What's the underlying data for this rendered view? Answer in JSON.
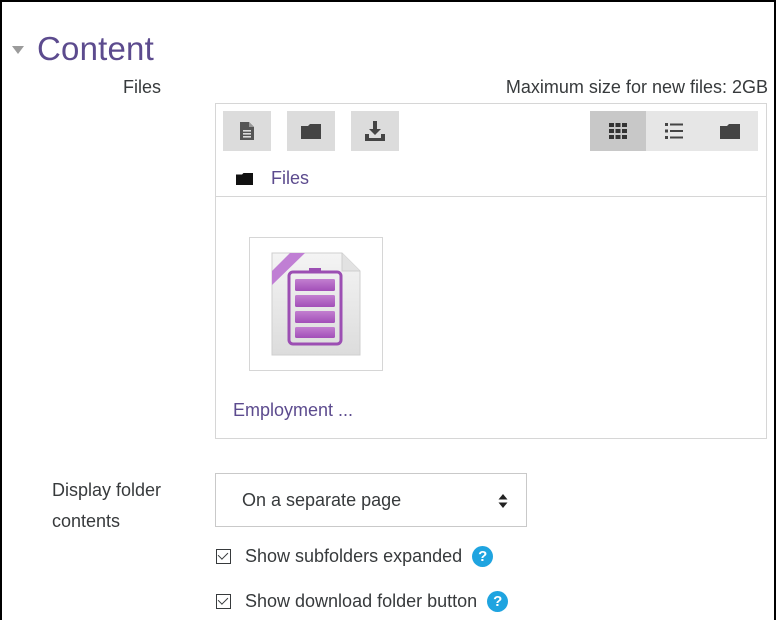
{
  "section": {
    "title": "Content"
  },
  "files_field": {
    "label": "Files",
    "max_size": "Maximum size for new files: 2GB"
  },
  "filepicker": {
    "toolbar": {
      "left_buttons": [
        "add-file-icon",
        "create-folder-icon",
        "download-icon"
      ],
      "view_buttons": [
        "grid-view-icon",
        "list-view-icon",
        "tree-view-icon"
      ],
      "active_view": "grid-view-icon"
    },
    "breadcrumb": "Files",
    "files": [
      {
        "name": "Employment ...",
        "icon": "spreadsheet-file-icon"
      }
    ]
  },
  "display_folder": {
    "label_line1": "Display folder",
    "label_line2": "contents",
    "selected": "On a separate page"
  },
  "options": [
    {
      "label": "Show subfolders expanded",
      "checked": true
    },
    {
      "label": "Show download folder button",
      "checked": true
    }
  ],
  "colors": {
    "accent": "#5c4b8e",
    "help": "#1fa4e0",
    "text": "#373a3c"
  }
}
